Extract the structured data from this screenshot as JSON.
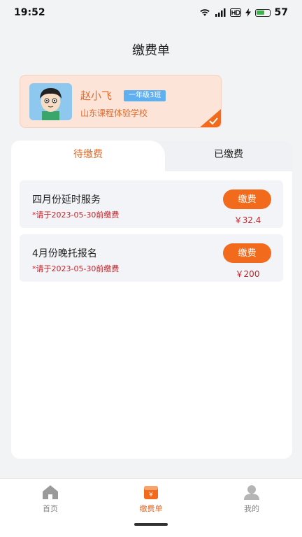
{
  "status_bar": {
    "time": "19:52",
    "battery": "57"
  },
  "header": {
    "title": "缴费单"
  },
  "student": {
    "name": "赵小飞",
    "grade": "一年级3班",
    "school": "山东课程体验学校"
  },
  "tabs": [
    {
      "label": "待缴费",
      "active": true
    },
    {
      "label": "已缴费",
      "active": false
    }
  ],
  "bills": [
    {
      "title": "四月份延时服务",
      "deadline": "*请于2023-05-30前缴费",
      "button": "缴费",
      "amount": "￥32.4"
    },
    {
      "title": "4月份晚托报名",
      "deadline": "*请于2023-05-30前缴费",
      "button": "缴费",
      "amount": "￥200"
    }
  ],
  "nav": [
    {
      "label": "首页",
      "icon": "home-icon"
    },
    {
      "label": "缴费单",
      "icon": "bill-icon",
      "active": true
    },
    {
      "label": "我的",
      "icon": "user-icon"
    }
  ],
  "colors": {
    "accent": "#f26a1b",
    "accent_text": "#e06a2a",
    "deadline": "#c0262b",
    "badge": "#5fb0f0"
  }
}
